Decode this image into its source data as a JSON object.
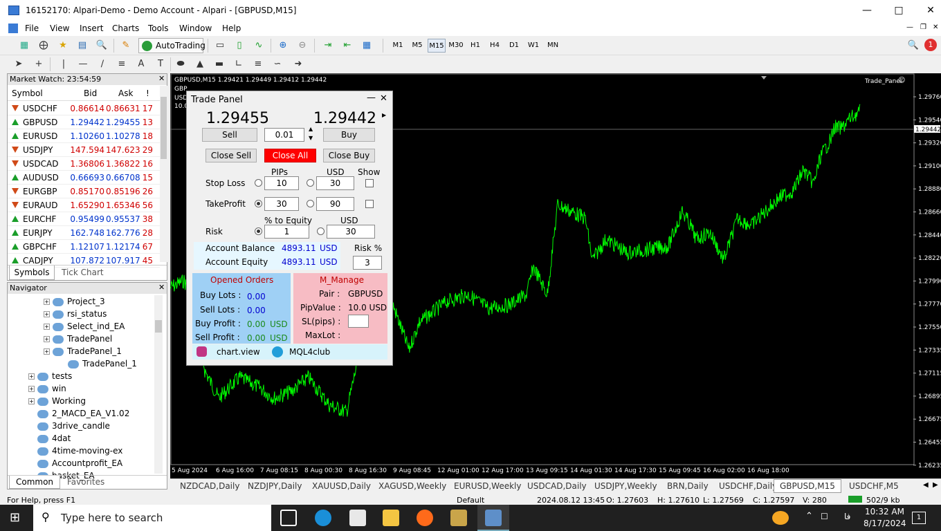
{
  "window": {
    "title": "16152170: Alpari-Demo - Demo Account - Alpari - [GBPUSD,M15]"
  },
  "menu": [
    "File",
    "View",
    "Insert",
    "Charts",
    "Tools",
    "Window",
    "Help"
  ],
  "toolbar": {
    "autotrading": "AutoTrading",
    "timeframes": [
      "M1",
      "M5",
      "M15",
      "M30",
      "H1",
      "H4",
      "D1",
      "W1",
      "MN"
    ],
    "active_timeframe": "M15"
  },
  "market_watch": {
    "title": "Market Watch: 23:54:59",
    "columns": [
      "Symbol",
      "Bid",
      "Ask",
      "!"
    ],
    "rows": [
      {
        "symbol": "USDCHF",
        "bid": "0.86614",
        "ask": "0.86631",
        "spread": "17",
        "dir": "down"
      },
      {
        "symbol": "GBPUSD",
        "bid": "1.29442",
        "ask": "1.29455",
        "spread": "13",
        "dir": "up"
      },
      {
        "symbol": "EURUSD",
        "bid": "1.10260",
        "ask": "1.10278",
        "spread": "18",
        "dir": "up"
      },
      {
        "symbol": "USDJPY",
        "bid": "147.594",
        "ask": "147.623",
        "spread": "29",
        "dir": "down"
      },
      {
        "symbol": "USDCAD",
        "bid": "1.36806",
        "ask": "1.36822",
        "spread": "16",
        "dir": "down"
      },
      {
        "symbol": "AUDUSD",
        "bid": "0.66693",
        "ask": "0.66708",
        "spread": "15",
        "dir": "up"
      },
      {
        "symbol": "EURGBP",
        "bid": "0.85170",
        "ask": "0.85196",
        "spread": "26",
        "dir": "down"
      },
      {
        "symbol": "EURAUD",
        "bid": "1.65290",
        "ask": "1.65346",
        "spread": "56",
        "dir": "down"
      },
      {
        "symbol": "EURCHF",
        "bid": "0.95499",
        "ask": "0.95537",
        "spread": "38",
        "dir": "up"
      },
      {
        "symbol": "EURJPY",
        "bid": "162.748",
        "ask": "162.776",
        "spread": "28",
        "dir": "up"
      },
      {
        "symbol": "GBPCHF",
        "bid": "1.12107",
        "ask": "1.12174",
        "spread": "67",
        "dir": "up"
      },
      {
        "symbol": "CADJPY",
        "bid": "107.872",
        "ask": "107.917",
        "spread": "45",
        "dir": "up"
      }
    ],
    "tabs": [
      "Symbols",
      "Tick Chart"
    ]
  },
  "navigator": {
    "title": "Navigator",
    "items": [
      {
        "label": "Project_3"
      },
      {
        "label": "rsi_status"
      },
      {
        "label": "Select_ind_EA"
      },
      {
        "label": "TradePanel"
      },
      {
        "label": "TradePanel_1"
      },
      {
        "label": "TradePanel_1"
      },
      {
        "label": "tests"
      },
      {
        "label": "win"
      },
      {
        "label": "Working"
      },
      {
        "label": "2_MACD_EA_V1.02"
      },
      {
        "label": "3drive_candle"
      },
      {
        "label": "4dat"
      },
      {
        "label": "4time-moving-ex"
      },
      {
        "label": "Accountprofit_EA"
      },
      {
        "label": "basket_EA"
      }
    ],
    "tabs": [
      "Common",
      "Favorites"
    ]
  },
  "chart": {
    "header": "GBPUSD,M15  1.29421 1.29449 1.29412 1.29442",
    "sub1": "GBP",
    "sub2": "USD",
    "sub3": "10.0",
    "panel_tag": "Trade_Panel",
    "bid_tag": "1.29442",
    "price_levels": [
      "1.29760",
      "1.29540",
      "1.29320",
      "1.29100",
      "1.28880",
      "1.28660",
      "1.28440",
      "1.28220",
      "1.27990",
      "1.27770",
      "1.27550",
      "1.27335",
      "1.27115",
      "1.26895",
      "1.26675",
      "1.26455",
      "1.26235"
    ],
    "time_labels": [
      "5 Aug 2024",
      "6 Aug 16:00",
      "7 Aug 08:15",
      "8 Aug 00:30",
      "8 Aug 16:30",
      "9 Aug 08:45",
      "12 Aug 01:00",
      "12 Aug 17:00",
      "13 Aug 09:15",
      "14 Aug 01:30",
      "14 Aug 17:30",
      "15 Aug 09:45",
      "16 Aug 02:00",
      "16 Aug 18:00"
    ],
    "line_color": "#00ff00",
    "background": "#000000"
  },
  "trade_panel": {
    "title": "Trade Panel",
    "sell_price": "1.29455",
    "buy_price": "1.29442",
    "sell": "Sell",
    "buy": "Buy",
    "lot": "0.01",
    "close_sell": "Close Sell",
    "close_all": "Close All",
    "close_buy": "Close Buy",
    "pips": "PIPs",
    "usd": "USD",
    "show": "Show",
    "stop_loss": "Stop Loss",
    "sl_pips": "10",
    "sl_usd": "30",
    "take_profit": "TakeProfit",
    "tp_pips": "30",
    "tp_usd": "90",
    "pct_equity": "% to Equity",
    "usd2": "USD",
    "risk": "Risk",
    "risk_pct": "1",
    "risk_usd": "30",
    "account_balance_label": "Account Balance",
    "account_balance": "4893.11",
    "account_equity_label": "Account Equity",
    "account_equity": "4893.11",
    "cur": "USD",
    "risk_pct_label": "Risk %",
    "risk_pct_value": "3",
    "opened_orders": "Opened Orders",
    "buy_lots_label": "Buy Lots :",
    "buy_lots": "0.00",
    "sell_lots_label": "Sell Lots :",
    "sell_lots": "0.00",
    "buy_profit_label": "Buy Profit :",
    "buy_profit": "0.00",
    "sell_profit_label": "Sell Profit :",
    "sell_profit": "0.00",
    "m_manage": "M_Manage",
    "pair_label": "Pair :",
    "pair": "GBPUSD",
    "pipvalue_label": "PipValue :",
    "pipvalue": "10.0 USD",
    "slpips_label": "SL(pips) :",
    "maxlot_label": "MaxLot :",
    "insta": "chart.view",
    "telegram": "MQL4club"
  },
  "chart_tabs": [
    "NZDCAD,Daily",
    "NZDJPY,Daily",
    "XAUUSD,Daily",
    "XAGUSD,Weekly",
    "EURUSD,Weekly",
    "USDCAD,Daily",
    "USDJPY,Weekly",
    "BRN,Daily",
    "USDCHF,Daily",
    "GBPUSD,M15",
    "USDCHF,M5"
  ],
  "active_chart_tab": "GBPUSD,M15",
  "status": {
    "help": "For Help, press F1",
    "profile": "Default",
    "datetime": "2024.08.12 13:45",
    "open": "O: 1.27603",
    "high": "H: 1.27610",
    "low": "L: 1.27569",
    "close": "C: 1.27597",
    "volume": "V: 280",
    "traffic": "502/9 kb"
  },
  "taskbar": {
    "search_placeholder": "Type here to search",
    "time": "10:32 AM",
    "date": "8/17/2024",
    "lang": "فا",
    "notifications": "1"
  }
}
